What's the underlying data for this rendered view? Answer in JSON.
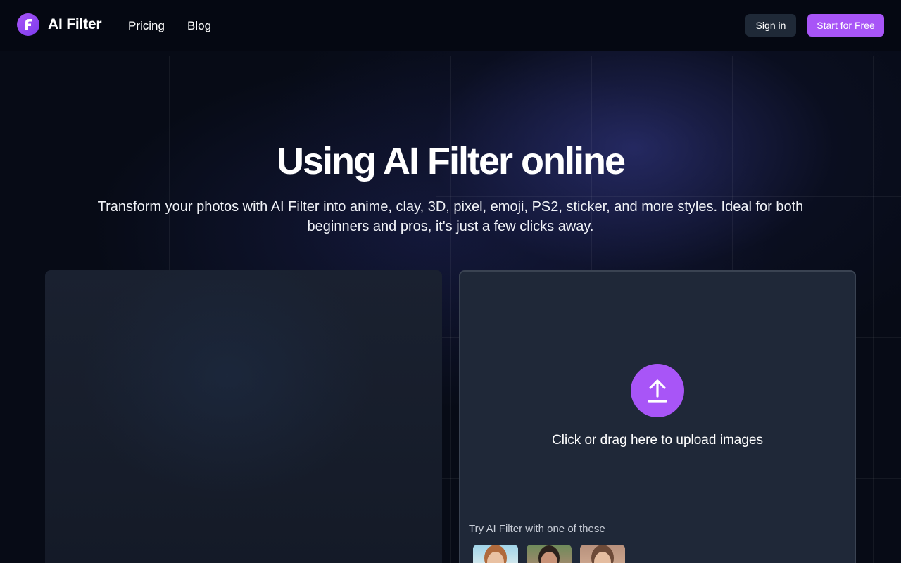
{
  "header": {
    "brand": "AI Filter",
    "nav": {
      "pricing": "Pricing",
      "blog": "Blog"
    },
    "sign_in_label": "Sign in",
    "start_label": "Start for Free"
  },
  "hero": {
    "title": "Using AI Filter online",
    "subtitle": "Transform your photos with AI Filter into anime, clay, 3D, pixel, emoji, PS2, sticker, and more styles. Ideal for both beginners and pros, it's just a few clicks away."
  },
  "upload": {
    "prompt": "Click or drag here to upload images",
    "try_label": "Try AI Filter with one of these",
    "icon": "upload-arrow-icon"
  },
  "colors": {
    "accent": "#a855f7",
    "background": "#070b16",
    "panel": "#1f2838",
    "sign_in_bg": "#1f2937"
  }
}
